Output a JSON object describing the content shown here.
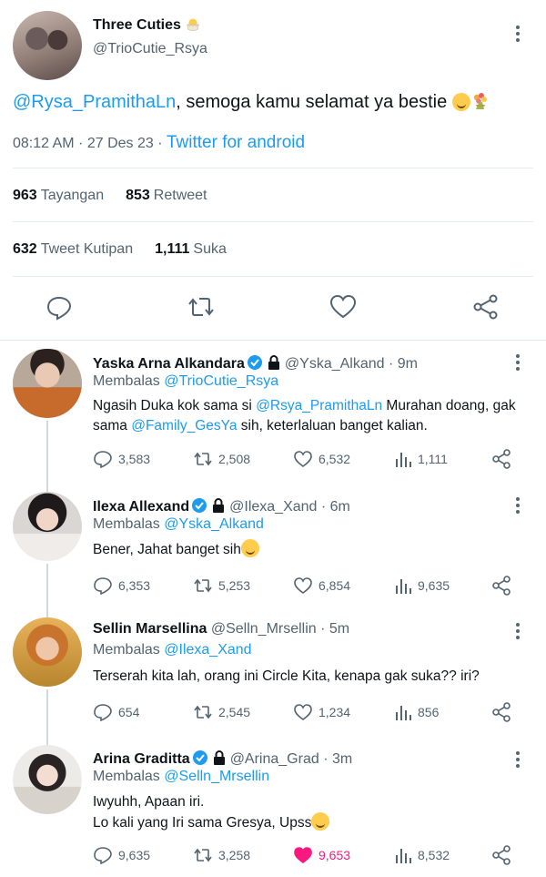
{
  "tweet": {
    "author_name": "Three Cuties",
    "author_handle": "@TrioCutie_Rsya",
    "mention": "@Rysa_PramithaLn",
    "text": ", semoga kamu selamat ya bestie ",
    "time": "08:12 AM · 27 Des 23 · ",
    "source": "Twitter for android",
    "views_count": "963",
    "views_label": "Tayangan",
    "retweets_count": "853",
    "retweets_label": "Retweet",
    "quotes_count": "632",
    "quotes_label": "Tweet Kutipan",
    "likes_count": "1,111",
    "likes_label": "Suka"
  },
  "replies": [
    {
      "name": "Yaska Arna Alkandara",
      "handle": "@Yska_Alkand",
      "time": " · 9m",
      "replying_prefix": "Membalas ",
      "replying_to": "@TrioCutie_Rsya",
      "text_1": "Ngasih Duka kok sama si ",
      "mention_1": "@Rsya_PramithaLn",
      "text_2": " Murahan doang, gak sama ",
      "mention_2": "@Family_GesYa",
      "text_3": " sih, keterlaluan banget kalian.",
      "comments": "3,583",
      "retweets": "2,508",
      "likes": "6,532",
      "views": "1,111"
    },
    {
      "name": "Ilexa Allexand",
      "handle": "@Ilexa_Xand",
      "time": " · 6m",
      "replying_prefix": "Membalas ",
      "replying_to": "@Yska_Alkand",
      "text_1": "Bener, Jahat banget sih",
      "comments": "6,353",
      "retweets": "5,253",
      "likes": "6,854",
      "views": "9,635"
    },
    {
      "name": "Sellin Marsellina",
      "handle": "@Selln_Mrsellin",
      "time": " · 5m",
      "replying_prefix": "Membalas ",
      "replying_to": "@Ilexa_Xand",
      "text_1": "Terserah kita lah, orang ini Circle Kita, kenapa gak suka?? iri?",
      "comments": "654",
      "retweets": "2,545",
      "likes": "1,234",
      "views": "856"
    },
    {
      "name": "Arina Graditta",
      "handle": "@Arina_Grad",
      "time": " · 3m",
      "replying_prefix": "Membalas ",
      "replying_to": "@Selln_Mrsellin",
      "text_1": "Iwyuhh, Apaan iri.",
      "text_2": "Lo kali yang Iri sama Gresya, Upss",
      "comments": "9,635",
      "retweets": "3,258",
      "likes": "9,653",
      "views": "8,532",
      "liked": true
    }
  ],
  "colors": {
    "accent": "#1d9bf0",
    "text": "#0f1419",
    "secondary": "#536471",
    "liked": "#f91880"
  }
}
